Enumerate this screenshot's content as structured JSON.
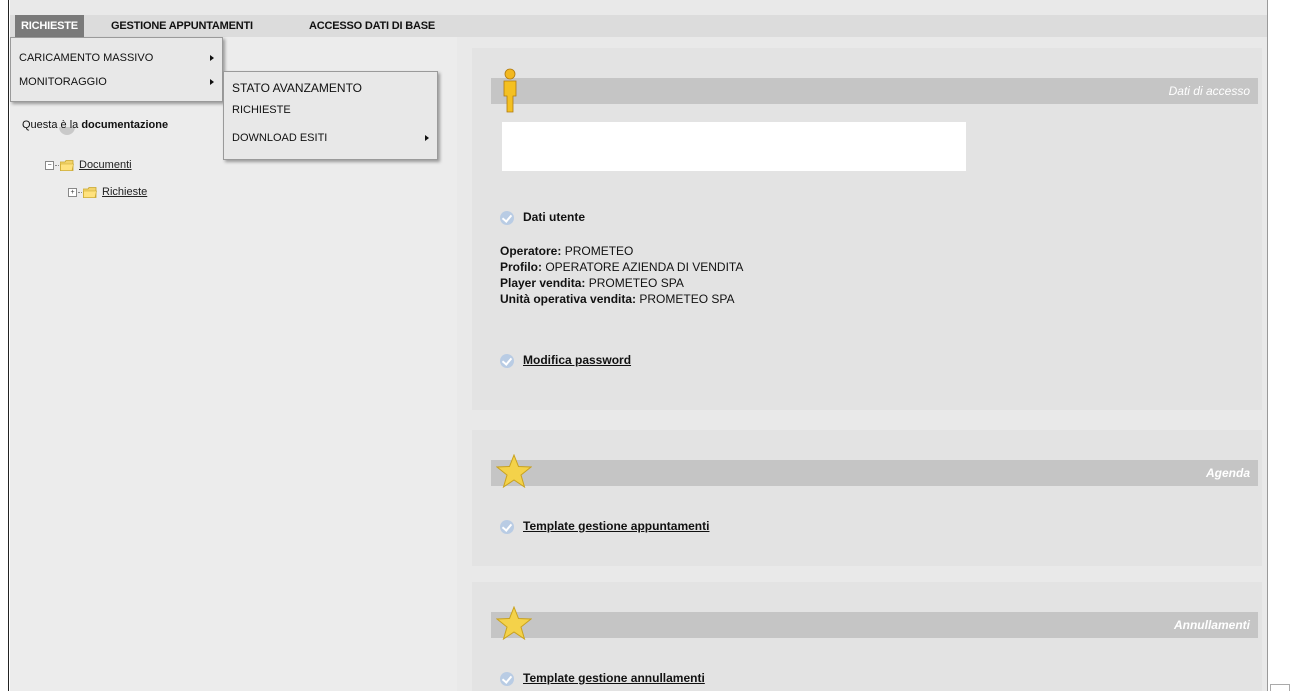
{
  "menubar": {
    "items": [
      "RICHIESTE",
      "GESTIONE APPUNTAMENTI",
      "ACCESSO DATI DI BASE"
    ]
  },
  "dropdown": {
    "items": [
      "CARICAMENTO MASSIVO",
      "MONITORAGGIO"
    ]
  },
  "submenu": {
    "items": [
      "STATO AVANZAMENTO",
      "RICHIESTE",
      "DOWNLOAD ESITI"
    ]
  },
  "left": {
    "intro_prefix": "Questa è la ",
    "intro_bold": "documentazione",
    "tree": [
      "Documenti",
      "Richieste"
    ]
  },
  "access_panel": {
    "title": "Dati di accesso",
    "section_title": "Dati utente",
    "fields": [
      {
        "label": "Operatore:",
        "value": " PROMETEO"
      },
      {
        "label": "Profilo:",
        "value": " OPERATORE AZIENDA DI VENDITA"
      },
      {
        "label": "Player vendita:",
        "value": " PROMETEO SPA"
      },
      {
        "label": "Unità operativa vendita:",
        "value": " PROMETEO SPA"
      }
    ],
    "password_link": "Modifica password"
  },
  "agenda_panel": {
    "title": "Agenda",
    "link": "Template gestione appuntamenti"
  },
  "annullamenti_panel": {
    "title": "Annullamenti",
    "link": "Template gestione annullamenti"
  },
  "icons": {
    "user": "person-icon",
    "star": "star-icon",
    "check": "check-circle-icon",
    "folder": "folder-icon"
  },
  "colors": {
    "active_menu": "#7a7a7a",
    "panel_bg": "#e3e3e3",
    "bar_bg": "#c5c5c5",
    "check": "#b9cce4"
  }
}
